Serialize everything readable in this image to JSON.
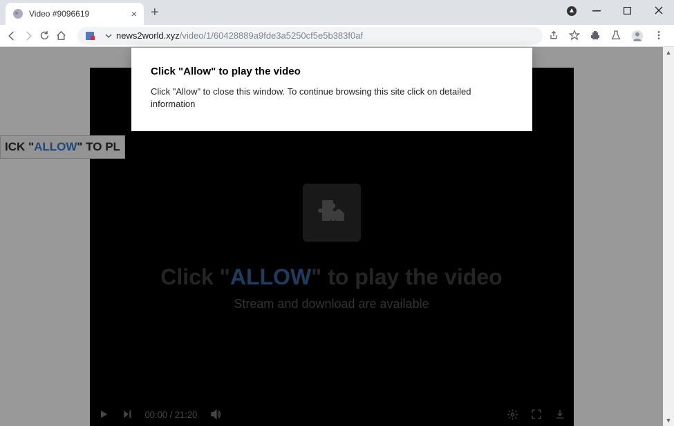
{
  "tab": {
    "title": "Video #9096619"
  },
  "url": {
    "host": "news2world.xyz",
    "path": "/video/1/60428889a9fde3a5250cf5e5b383f0af"
  },
  "popup": {
    "title": "Click \"Allow\" to play the video",
    "body": "Click \"Allow\" to close this window. To continue browsing this site click on detailed information"
  },
  "banner": {
    "prefix": "ICK \"",
    "allow": "ALLOW",
    "suffix": "\" TO PL"
  },
  "hero": {
    "prefix": "Click \"",
    "allow": "ALLOW",
    "suffix": "\" to play the video",
    "subtitle": "Stream and download are available"
  },
  "player": {
    "time": "00:00 / 21:20"
  }
}
